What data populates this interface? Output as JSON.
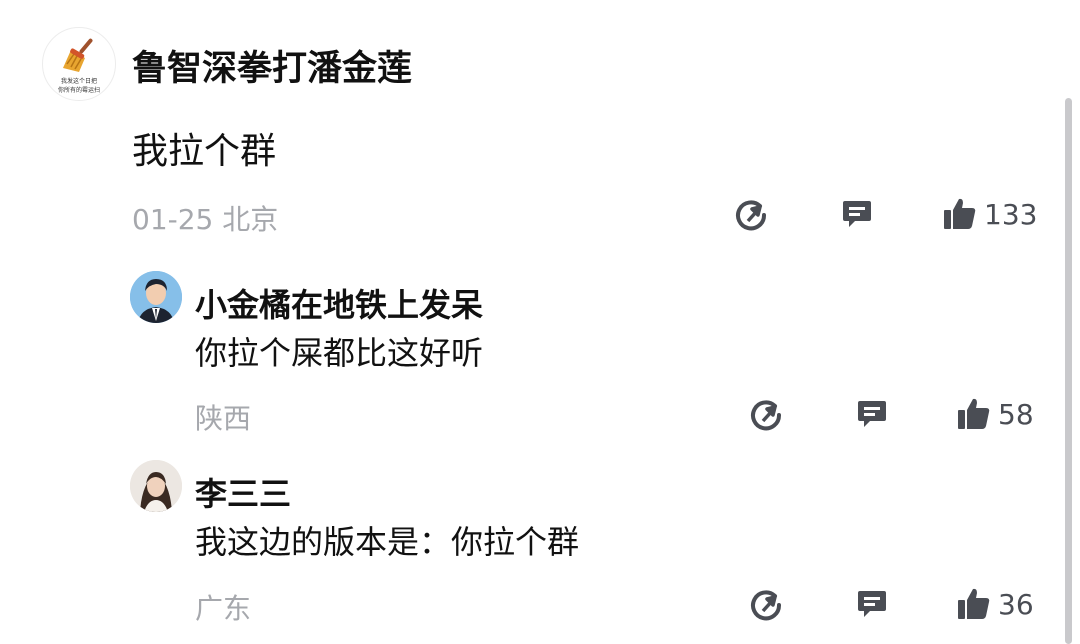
{
  "post": {
    "author": "鲁智深拳打潘金莲",
    "avatar_caption_1": "我发这个日把",
    "avatar_caption_2": "你所有的霉运扫",
    "content": "我拉个群",
    "meta": "01-25 北京",
    "likes": "133"
  },
  "replies": [
    {
      "author": "小金橘在地铁上发呆",
      "content": "你拉个屎都比这好听",
      "location": "陕西",
      "likes": "58"
    },
    {
      "author": "李三三",
      "content": "我这边的版本是：你拉个群",
      "location": "广东",
      "likes": "36"
    }
  ],
  "icons": {
    "share": "share-icon",
    "comment": "comment-icon",
    "like": "thumbs-up-icon"
  },
  "colors": {
    "text": "#111111",
    "meta": "#a6a8ad",
    "icon": "#4a4d54"
  }
}
